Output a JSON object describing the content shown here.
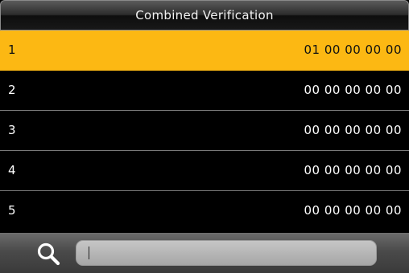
{
  "header": {
    "title": "Combined Verification"
  },
  "list": {
    "selected_index": 0,
    "rows": [
      {
        "index": "1",
        "value": "01 00 00 00 00"
      },
      {
        "index": "2",
        "value": "00 00 00 00 00"
      },
      {
        "index": "3",
        "value": "00 00 00 00 00"
      },
      {
        "index": "4",
        "value": "00 00 00 00 00"
      },
      {
        "index": "5",
        "value": "00 00 00 00 00"
      }
    ]
  },
  "search": {
    "icon": "search-icon",
    "value": ""
  },
  "colors": {
    "selected_row": "#fcb813",
    "background": "#000000",
    "divider": "#7a7a7a"
  }
}
